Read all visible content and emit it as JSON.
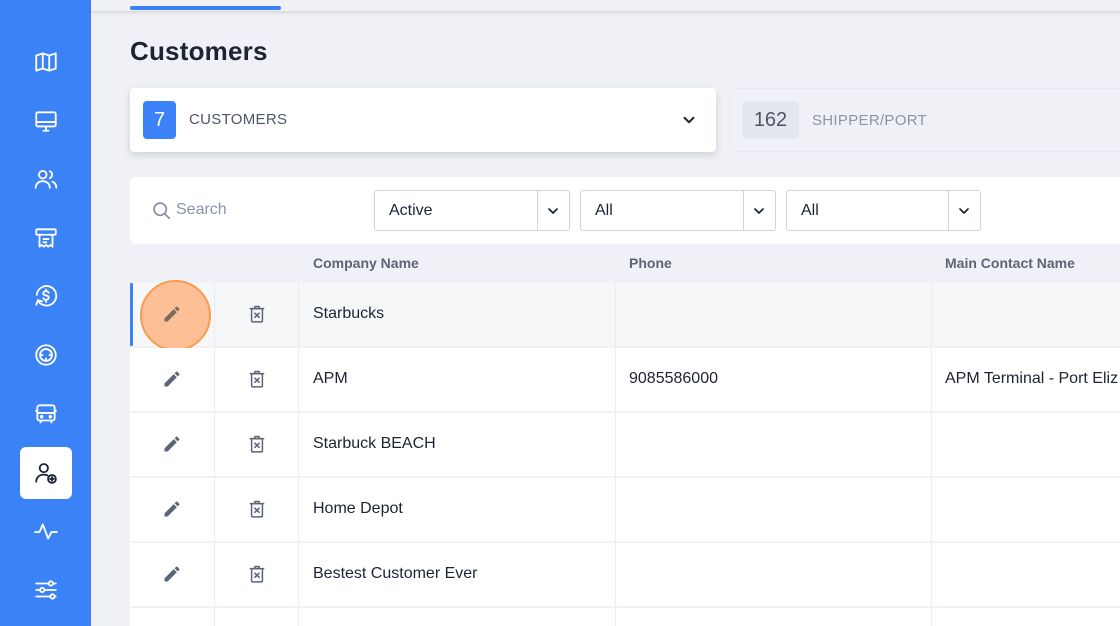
{
  "page": {
    "title": "Customers"
  },
  "sidebar": {
    "items": [
      {
        "icon": "map-icon",
        "active": false
      },
      {
        "icon": "monitor-icon",
        "active": false
      },
      {
        "icon": "users-icon",
        "active": false
      },
      {
        "icon": "receipt-icon",
        "active": false
      },
      {
        "icon": "dollar-icon",
        "active": false
      },
      {
        "icon": "steering-wheel-icon",
        "active": false
      },
      {
        "icon": "bus-icon",
        "active": false
      },
      {
        "icon": "customer-settings-icon",
        "active": true
      },
      {
        "icon": "activity-icon",
        "active": false
      },
      {
        "icon": "sliders-icon",
        "active": false
      }
    ]
  },
  "cards": {
    "customers": {
      "count": "7",
      "label": "CUSTOMERS"
    },
    "shipper": {
      "count": "162",
      "label": "SHIPPER/PORT"
    }
  },
  "filters": {
    "search_placeholder": "Search",
    "status": "Active",
    "filter2": "All",
    "filter3": "All"
  },
  "table": {
    "columns": [
      "Company Name",
      "Phone",
      "Main Contact Name"
    ],
    "rows": [
      {
        "company": "Starbucks",
        "phone": "",
        "contact": ""
      },
      {
        "company": "APM",
        "phone": "9085586000",
        "contact": "APM Terminal - Port Eliz"
      },
      {
        "company": "Starbuck BEACH",
        "phone": "",
        "contact": ""
      },
      {
        "company": "Home Depot",
        "phone": "",
        "contact": ""
      },
      {
        "company": "Bestest Customer Ever",
        "phone": "",
        "contact": ""
      }
    ]
  },
  "colors": {
    "accent": "#3b82f6",
    "highlight": "#fb923c",
    "icon_grey": "#5b6577"
  }
}
